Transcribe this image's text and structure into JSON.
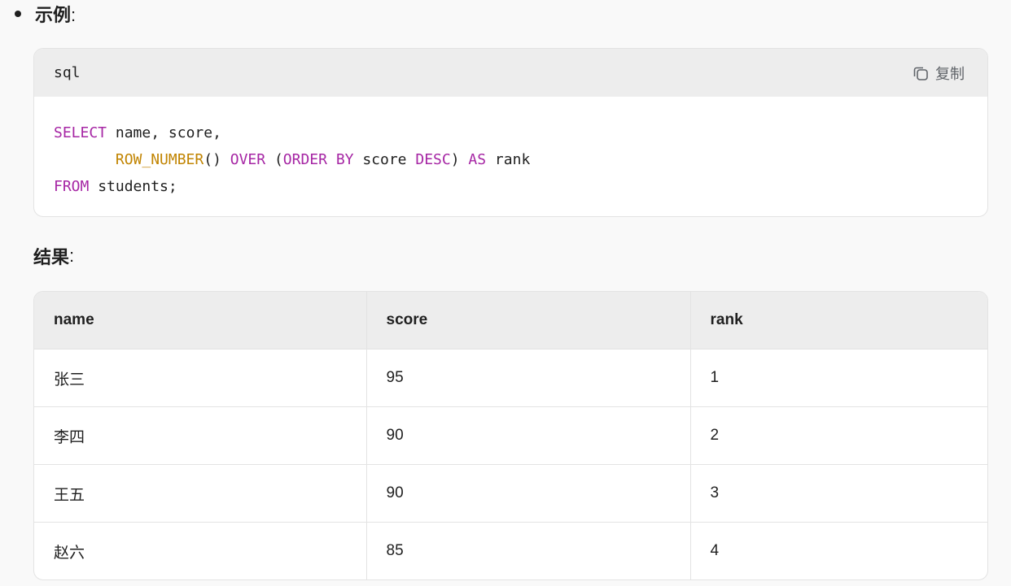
{
  "example_heading": {
    "label": "示例",
    "colon": ":"
  },
  "code_block": {
    "language": "sql",
    "copy_label": "复制",
    "lines": [
      [
        {
          "t": "SELECT",
          "c": "kw"
        },
        {
          "t": " name, score,",
          "c": ""
        }
      ],
      [
        {
          "t": "       ",
          "c": ""
        },
        {
          "t": "ROW_NUMBER",
          "c": "fn"
        },
        {
          "t": "() ",
          "c": ""
        },
        {
          "t": "OVER",
          "c": "kw"
        },
        {
          "t": " (",
          "c": ""
        },
        {
          "t": "ORDER BY",
          "c": "kw"
        },
        {
          "t": " score ",
          "c": ""
        },
        {
          "t": "DESC",
          "c": "kw"
        },
        {
          "t": ") ",
          "c": ""
        },
        {
          "t": "AS",
          "c": "kw"
        },
        {
          "t": " rank",
          "c": ""
        }
      ],
      [
        {
          "t": "FROM",
          "c": "kw"
        },
        {
          "t": " students;",
          "c": ""
        }
      ]
    ]
  },
  "result_heading": {
    "label": "结果",
    "colon": ":"
  },
  "result_table": {
    "columns": [
      "name",
      "score",
      "rank"
    ],
    "rows": [
      [
        "张三",
        "95",
        "1"
      ],
      [
        "李四",
        "90",
        "2"
      ],
      [
        "王五",
        "90",
        "3"
      ],
      [
        "赵六",
        "85",
        "4"
      ]
    ]
  },
  "colors": {
    "keyword": "#a626a4",
    "function": "#c18401",
    "header_bg": "#ededed",
    "border": "#e3e3e3"
  }
}
